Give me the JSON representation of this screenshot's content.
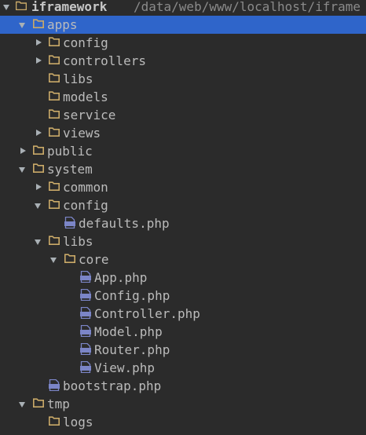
{
  "root": {
    "label": "iframework",
    "path": "/data/web/www/localhost/iframe"
  },
  "colors": {
    "background": "#2b2b2b",
    "selection": "#2f65ca",
    "folder_icon": "#c9a968",
    "php_icon": "#7b85c7",
    "text": "#bbbbbb"
  },
  "rows": [
    {
      "label": "apps",
      "type": "folder",
      "depth": 1,
      "state": "expanded",
      "selected": true
    },
    {
      "label": "config",
      "type": "folder",
      "depth": 2,
      "state": "collapsed"
    },
    {
      "label": "controllers",
      "type": "folder",
      "depth": 2,
      "state": "collapsed"
    },
    {
      "label": "libs",
      "type": "folder",
      "depth": 2,
      "state": "none"
    },
    {
      "label": "models",
      "type": "folder",
      "depth": 2,
      "state": "none"
    },
    {
      "label": "service",
      "type": "folder",
      "depth": 2,
      "state": "none"
    },
    {
      "label": "views",
      "type": "folder",
      "depth": 2,
      "state": "collapsed"
    },
    {
      "label": "public",
      "type": "folder",
      "depth": 1,
      "state": "collapsed"
    },
    {
      "label": "system",
      "type": "folder",
      "depth": 1,
      "state": "expanded"
    },
    {
      "label": "common",
      "type": "folder",
      "depth": 2,
      "state": "collapsed"
    },
    {
      "label": "config",
      "type": "folder",
      "depth": 2,
      "state": "expanded"
    },
    {
      "label": "defaults.php",
      "type": "php",
      "depth": 3,
      "state": "none"
    },
    {
      "label": "libs",
      "type": "folder",
      "depth": 2,
      "state": "expanded"
    },
    {
      "label": "core",
      "type": "folder",
      "depth": 3,
      "state": "expanded"
    },
    {
      "label": "App.php",
      "type": "php",
      "depth": 4,
      "state": "none"
    },
    {
      "label": "Config.php",
      "type": "php",
      "depth": 4,
      "state": "none"
    },
    {
      "label": "Controller.php",
      "type": "php",
      "depth": 4,
      "state": "none"
    },
    {
      "label": "Model.php",
      "type": "php",
      "depth": 4,
      "state": "none"
    },
    {
      "label": "Router.php",
      "type": "php",
      "depth": 4,
      "state": "none"
    },
    {
      "label": "View.php",
      "type": "php",
      "depth": 4,
      "state": "none"
    },
    {
      "label": "bootstrap.php",
      "type": "php",
      "depth": 2,
      "state": "none"
    },
    {
      "label": "tmp",
      "type": "folder",
      "depth": 1,
      "state": "expanded"
    },
    {
      "label": "logs",
      "type": "folder",
      "depth": 2,
      "state": "none"
    }
  ]
}
